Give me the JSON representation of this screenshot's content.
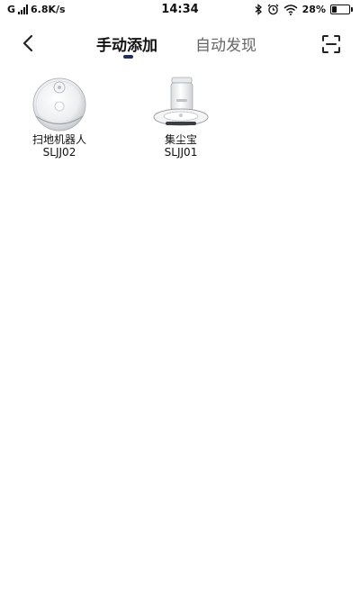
{
  "status_bar": {
    "network_type": "G",
    "speed": "6.8K/s",
    "time": "14:34",
    "battery": "28%",
    "battery_level": 0.28
  },
  "header": {
    "tabs": [
      {
        "label": "手动添加",
        "active": true
      },
      {
        "label": "自动发现",
        "active": false
      }
    ],
    "back_icon": "chevron-left-icon",
    "scan_icon": "scan-icon",
    "accent_color": "#1b2f66"
  },
  "devices": [
    {
      "name": "扫地机器人",
      "model": "SLJJ02",
      "icon": "robot-vacuum-icon"
    },
    {
      "name": "集尘宝",
      "model": "SLJJ01",
      "icon": "dust-station-icon"
    }
  ]
}
